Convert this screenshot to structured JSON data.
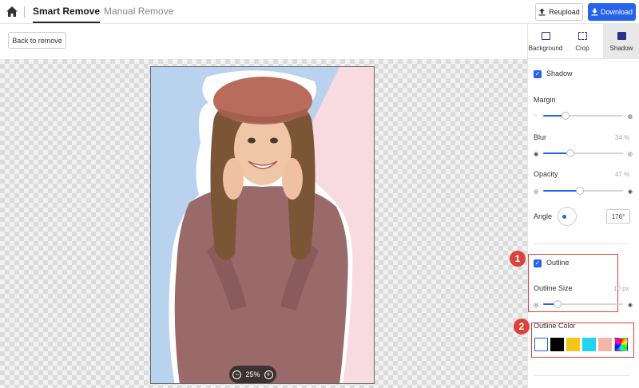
{
  "topbar": {
    "tabs": [
      {
        "label": "Smart Remove"
      },
      {
        "label": "Manual Remove"
      }
    ],
    "reupload_label": "Reupload",
    "download_label": "Download"
  },
  "subbar": {
    "back_label": "Back to remove"
  },
  "canvas": {
    "zoom_label": "25%"
  },
  "panel": {
    "tabs": [
      {
        "label": "Background"
      },
      {
        "label": "Crop"
      },
      {
        "label": "Shadow"
      }
    ],
    "shadow": {
      "checkbox_label": "Shadow",
      "margin": {
        "label": "Margin"
      },
      "blur": {
        "label": "Blur",
        "value_text": "34 %",
        "value": 0.34
      },
      "opacity": {
        "label": "Opacity",
        "value_text": "47 %",
        "value": 0.47
      },
      "angle": {
        "label": "Angle",
        "value": "176°"
      }
    },
    "outline": {
      "checkbox_label": "Outline",
      "size_label": "Outline Size",
      "size_value": "10 px",
      "color_label": "Outline Color",
      "swatches": [
        "#ffffff",
        "#000000",
        "#f5c518",
        "#22d3ee",
        "#f4b6a6",
        "rainbow"
      ]
    }
  },
  "annotations": [
    {
      "number": "1"
    },
    {
      "number": "2"
    }
  ],
  "colors": {
    "accent": "#2563eb",
    "annotation": "#d9433a"
  }
}
